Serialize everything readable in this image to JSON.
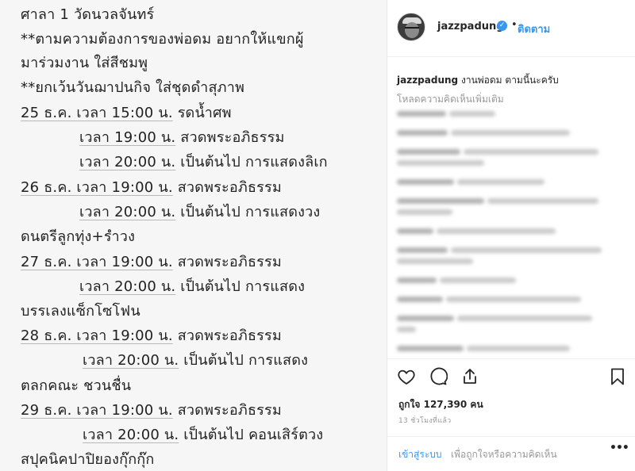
{
  "post": {
    "lines": [
      "ศาลา 1 วัดนวลจันทร์",
      "**ตามความต้องการของพ่อดม อยากให้แขกผู้",
      "มาร่วมงาน ใส่สีชมพู",
      "**ยกเว้นวันฌาปนกิจ ใส่ชุดดำสุภาพ",
      "25 ธ.ค. เวลา 15:00 น. รดน้ำศพ",
      "เวลา 19:00 น. สวดพระอภิธรรม",
      "เวลา 20:00 น. เป็นต้นไป การแสดงลิเก",
      "26 ธ.ค. เวลา 19:00 น. สวดพระอภิธรรม",
      "เวลา 20:00 น. เป็นต้นไป การแสดงวง",
      "ดนตรีลูกทุ่ง+รำวง",
      "27 ธ.ค. เวลา 19:00 น. สวดพระอภิธรรม",
      "เวลา 20:00 น. เป็นต้นไป การแสดง",
      "บรรเลงแซ็กโซโฟน",
      "28 ธ.ค. เวลา 19:00 น. สวดพระอภิธรรม",
      "เวลา 20:00 น. เป็นต้นไป การแสดง",
      "ตลกคณะ ชวนชื่น",
      "29 ธ.ค. เวลา 19:00 น. สวดพระอภิธรรม",
      "เวลา 20:00 น. เป็นต้นไป คอนเสิร์ตวง",
      "สปุคนิคปาปิยองกุ๊กกุ๊ก"
    ],
    "underlined": [
      "25 ธ.ค. เวลา 15:00 น.",
      "เวลา 19:00 น.",
      "เวลา 20:00 น.",
      "26 ธ.ค. เวลา 19:00 น.",
      "เวลา 20:00 น.",
      "27 ธ.ค. เวลา 19:00 น.",
      "เวลา 20:00 น.",
      "28 ธ.ค. เวลา 19:00 น.",
      "เวลา 20:00 น.",
      "29 ธ.ค. เวลา 19:00 น.",
      "เวลา 20:00 น."
    ]
  },
  "header": {
    "username": "jazzpadung",
    "separator": "•",
    "follow_label": "ติดตาม",
    "verified_icon": "verified-badge-icon"
  },
  "caption": {
    "username": "jazzpadung",
    "text": "งานพ่อดม ตามนี้นะครับ"
  },
  "comments": {
    "load_more": "โหลดความคิดเห็นเพิ่มเติม"
  },
  "actions": {
    "like_icon": "heart-icon",
    "comment_icon": "comment-icon",
    "share_icon": "share-icon",
    "save_icon": "bookmark-icon",
    "likes": "ถูกใจ 127,390 คน",
    "time": "13 ชั่วโมงที่แล้ว"
  },
  "login": {
    "link": "เข้าสู่ระบบ",
    "text": "เพื่อถูกใจหรือความคิดเห็น",
    "more": "•••"
  },
  "colors": {
    "link": "#3897f0",
    "text": "#262626",
    "muted": "#999999",
    "photo_bg": "#f6f6f6"
  }
}
